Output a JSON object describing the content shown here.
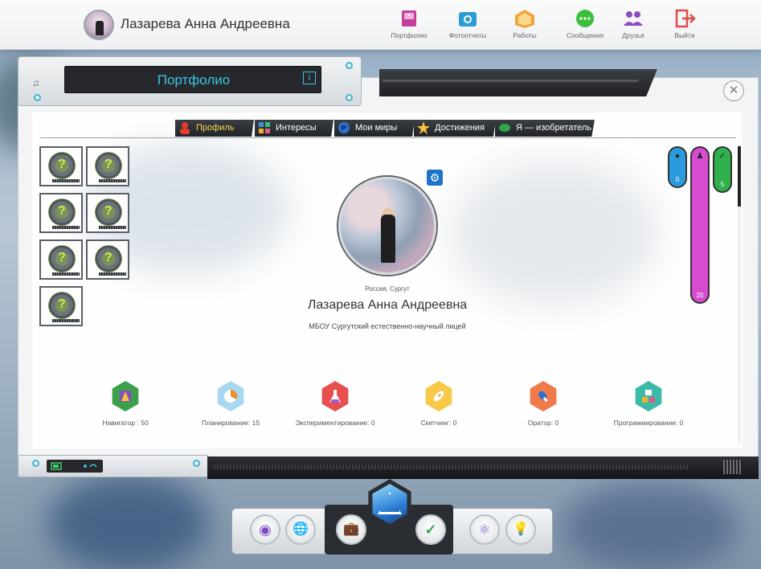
{
  "header": {
    "user_name": "Лазарева Анна Андреевна",
    "nav": [
      {
        "id": "portfolio",
        "label": "Портфолио",
        "icon": "portfolio-icon",
        "color": "#c23f9b"
      },
      {
        "id": "photo",
        "label": "Фотоотчеты",
        "icon": "camera-icon",
        "color": "#2d9bd3"
      },
      {
        "id": "works",
        "label": "Работы",
        "icon": "works-icon",
        "color": "#f2a43a"
      },
      {
        "id": "messages",
        "label": "Сообщения",
        "icon": "chat-icon",
        "color": "#3bbf3b"
      },
      {
        "id": "friends",
        "label": "Друзья",
        "icon": "friends-icon",
        "color": "#8c4cc0"
      },
      {
        "id": "logout",
        "label": "Выйти",
        "icon": "logout-icon",
        "color": "#e04c4c"
      }
    ]
  },
  "panel": {
    "title": "Портфолио",
    "info_glyph": "i",
    "close_glyph": "✕"
  },
  "tabs": [
    {
      "label": "Профиль",
      "active": true,
      "icon": "profile-icon",
      "color": "#e23c2f"
    },
    {
      "label": "Интересы",
      "active": false,
      "icon": "grid-icon",
      "color": "#3f8fe0"
    },
    {
      "label": "Мои миры",
      "active": false,
      "icon": "globe-icon",
      "color": "#2f6fd0"
    },
    {
      "label": "Достижения",
      "active": false,
      "icon": "star-icon",
      "color": "#f5c43b"
    },
    {
      "label": "Я — изобретатель",
      "active": false,
      "icon": "leaf-icon",
      "color": "#2ea64a"
    }
  ],
  "profile": {
    "location": "Россия, Сургут",
    "name": "Лазарева Анна Андреевна",
    "school": "МБОУ Сургутский естественно-научный лицей",
    "settings_glyph": "⚙"
  },
  "counters": [
    {
      "icon": "flask-icon",
      "value": "0",
      "color": "#2b9be0"
    },
    {
      "icon": "person-icon",
      "value": "20",
      "color": "#d64bd0"
    },
    {
      "icon": "check-icon",
      "value": "5",
      "color": "#2fb04a"
    }
  ],
  "skills": [
    {
      "label": "Навигатор : 50",
      "color": "#3aa04a",
      "icon": "navigator-icon"
    },
    {
      "label": "Планирование: 15",
      "color": "#a7d8f0",
      "icon": "pie-icon"
    },
    {
      "label": "Экспериментирование: 0",
      "color": "#e84f4f",
      "icon": "flask-icon"
    },
    {
      "label": "Скетчинг: 0",
      "color": "#f7c948",
      "icon": "rocket-icon"
    },
    {
      "label": "Оратор: 0",
      "color": "#f07a4a",
      "icon": "microphone-icon"
    },
    {
      "label": "Программирование: 0",
      "color": "#3bbaa7",
      "icon": "blocks-icon"
    }
  ],
  "dock": {
    "buttons": [
      {
        "icon": "eye-icon",
        "glyph": "◉",
        "color": "#7d4cc0"
      },
      {
        "icon": "planet-icon",
        "glyph": "🌐",
        "color": "#2d8bd0"
      },
      {
        "icon": "briefcase-icon",
        "glyph": "💼",
        "color": "#e25a2a"
      },
      {
        "icon": "check-icon",
        "glyph": "✓",
        "color": "#2fa64a"
      },
      {
        "icon": "atom-icon",
        "glyph": "⚛",
        "color": "#7a5bd0"
      },
      {
        "icon": "bulb-icon",
        "glyph": "💡",
        "color": "#f2b22a"
      }
    ]
  }
}
